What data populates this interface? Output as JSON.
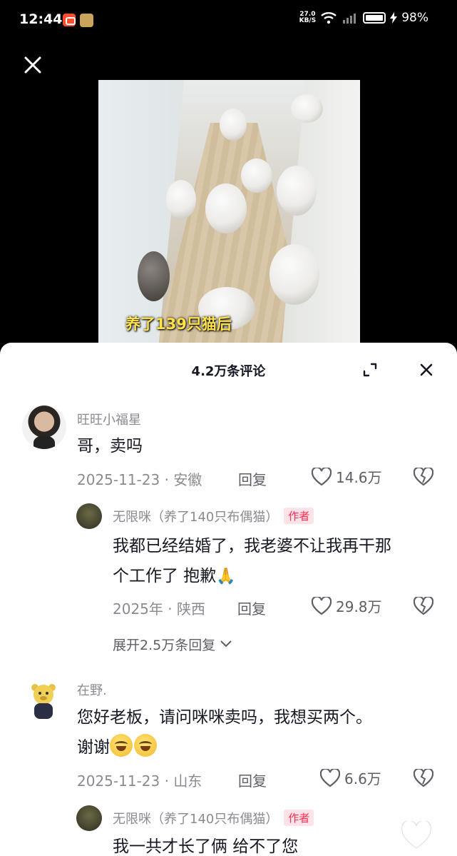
{
  "status_bar": {
    "time": "12:44",
    "net_speed_top": "27.0",
    "net_speed_bottom": "KB/S",
    "battery": "98%"
  },
  "video": {
    "caption": "养了139只猫后"
  },
  "comments_sheet": {
    "title": "4.2万条评论",
    "comments": [
      {
        "user": "旺旺小福星",
        "text": "哥，卖吗",
        "date": "2025-11-23",
        "location": "安徽",
        "reply_label": "回复",
        "likes": "14.6万",
        "replies": [
          {
            "user": "无限咪（养了140只布偶猫）",
            "badge": "作者",
            "text_line1": "我都已经结婚了，我老婆不让我再干那",
            "text_line2": "个工作了 抱歉",
            "date": "2025年",
            "location": "陕西",
            "reply_label": "回复",
            "likes": "29.8万"
          }
        ],
        "expand_label": "展开2.5万条回复"
      },
      {
        "user": "在野.",
        "text_line1": "您好老板，请问咪咪卖吗，我想买两个。",
        "text_line2": "谢谢",
        "date": "2025-11-23",
        "location": "山东",
        "reply_label": "回复",
        "likes": "6.6万",
        "replies": [
          {
            "user": "无限咪（养了140只布偶猫）",
            "badge": "作者",
            "text": "我一共才长了俩 给不了您"
          }
        ]
      }
    ]
  },
  "colors": {
    "accent": "#fe2c55",
    "caption": "#ffe14a",
    "meta_text": "#8a8b91"
  }
}
